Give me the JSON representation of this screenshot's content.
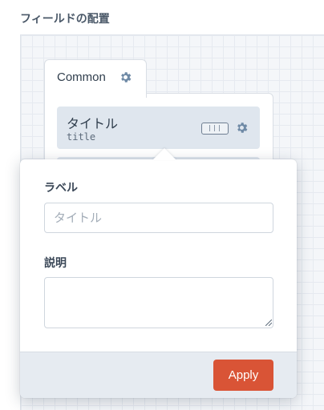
{
  "section": {
    "title": "フィールドの配置"
  },
  "tab": {
    "label": "Common",
    "icon": "gear-icon"
  },
  "field": {
    "label": "タイトル",
    "key": "title",
    "toggle_icon": "toggle-icon",
    "settings_icon": "gear-icon"
  },
  "popover": {
    "label_heading": "ラベル",
    "label_placeholder": "タイトル",
    "description_heading": "説明",
    "apply_label": "Apply"
  },
  "colors": {
    "accent": "#d95436",
    "field_bg": "#dfe6ee",
    "gear": "#6f8aa6"
  }
}
